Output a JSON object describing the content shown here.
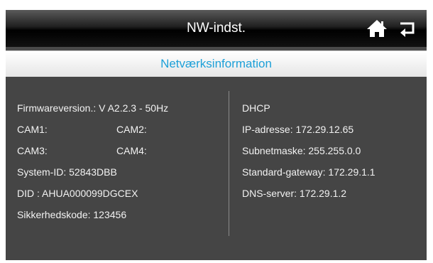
{
  "header": {
    "title": "NW-indst.",
    "home_icon": "home-icon",
    "back_icon": "return-icon"
  },
  "subheader": {
    "title": "Netværksinformation"
  },
  "left": {
    "firmware": "Firmwareversion.: V A2.2.3 - 50Hz",
    "cam1": "CAM1:",
    "cam2": "CAM2:",
    "cam3": "CAM3:",
    "cam4": "CAM4:",
    "system_id": "System-ID: 52843DBB",
    "did": "DID : AHUA000099DGCEX",
    "security_code": "Sikkerhedskode: 123456"
  },
  "right": {
    "mode": "DHCP",
    "ip": "IP-adresse: 172.29.12.65",
    "subnet": "Subnetmaske: 255.255.0.0",
    "gateway": "Standard-gateway: 172.29.1.1",
    "dns": "DNS-server: 172.29.1.2"
  },
  "colors": {
    "accent": "#1da0d8",
    "panel": "#454545",
    "text": "#f2f2f2"
  }
}
